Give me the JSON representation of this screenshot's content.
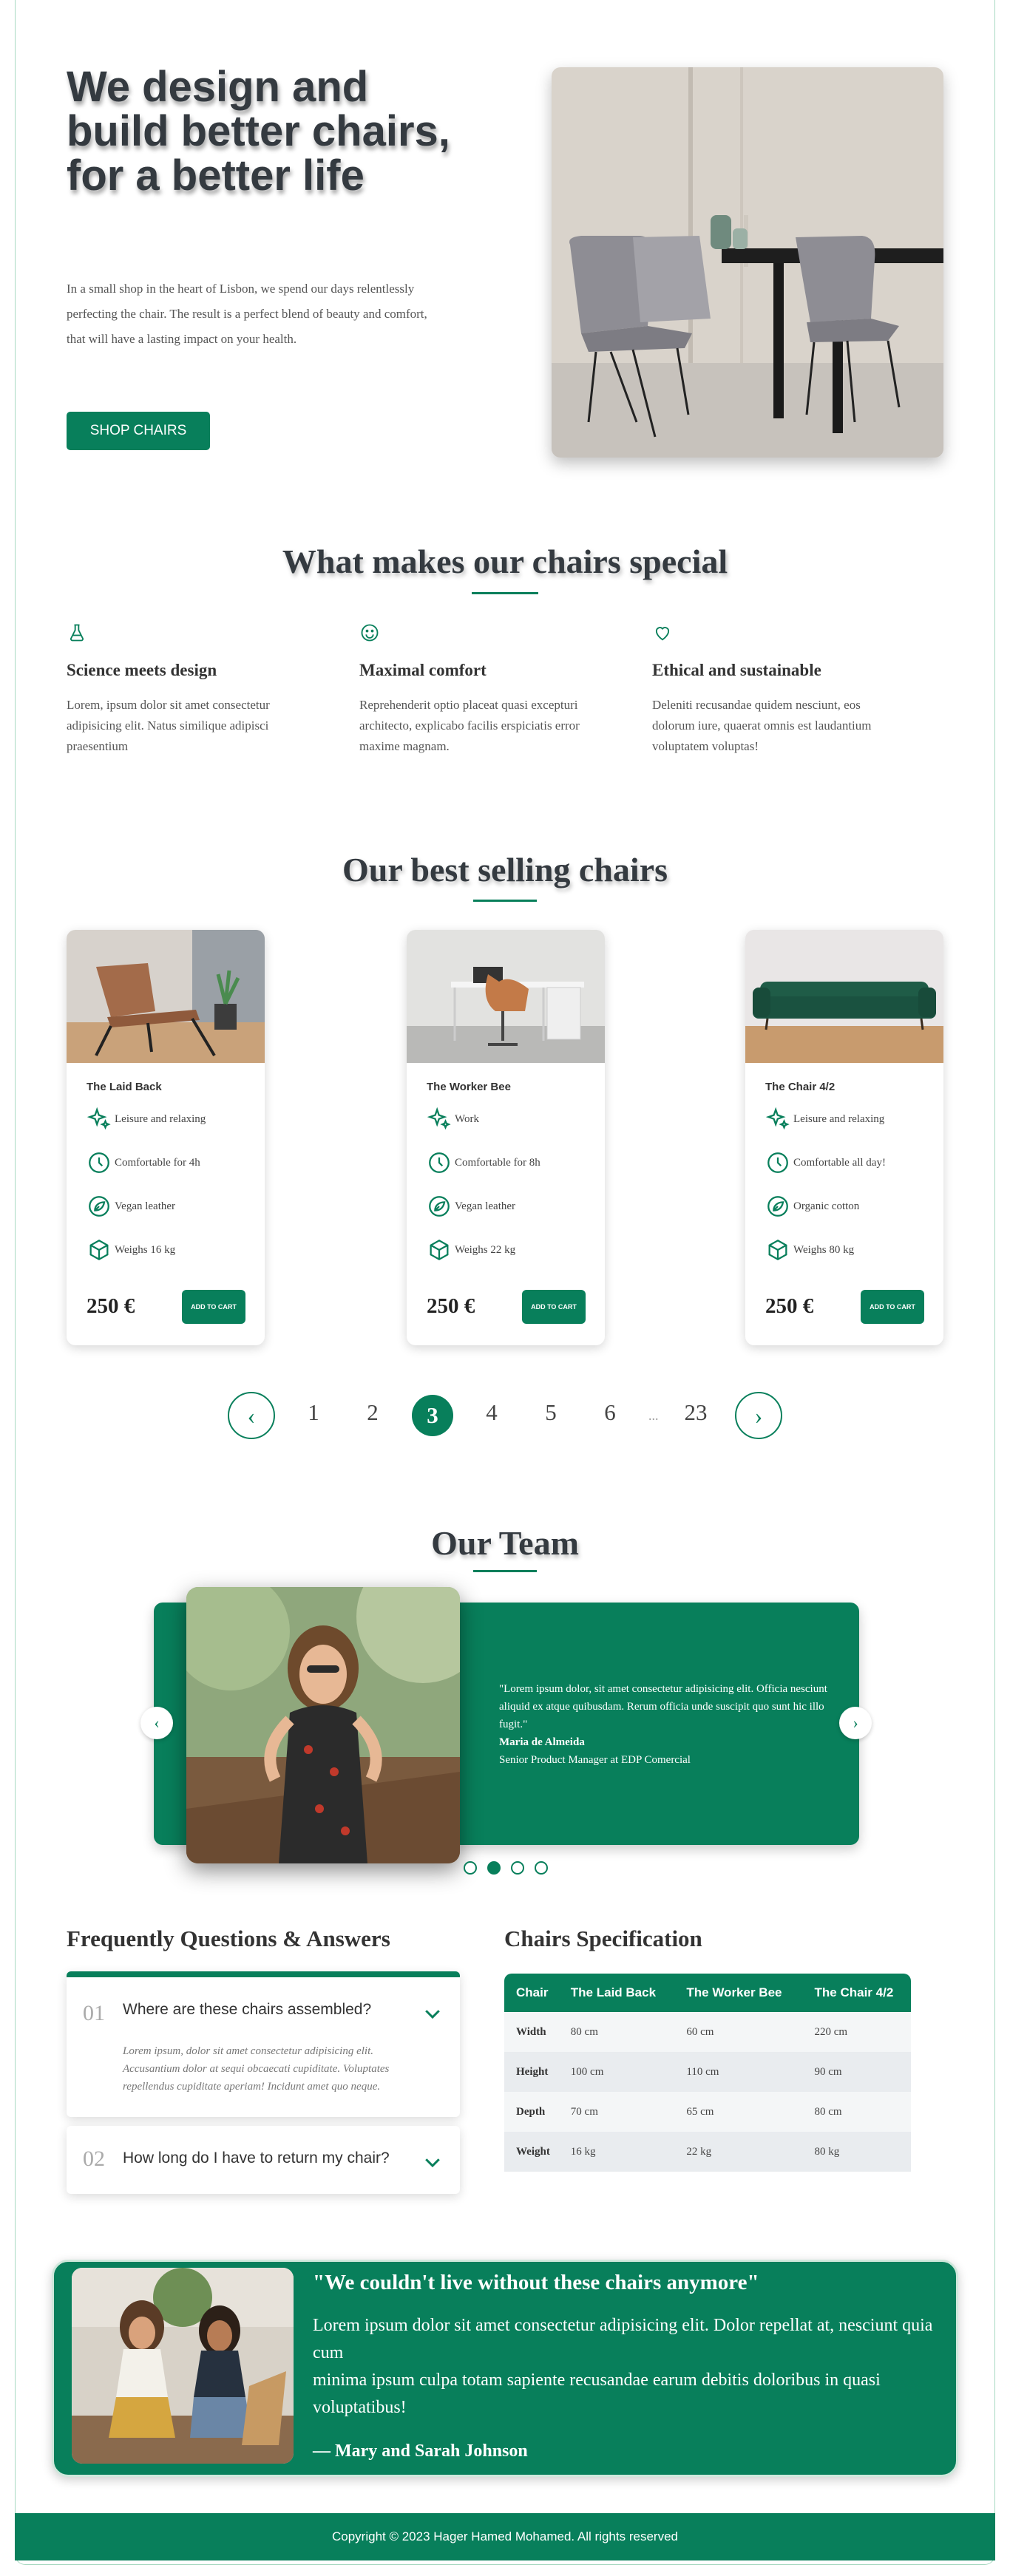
{
  "hero": {
    "title": "We design and build better chairs, for a better life",
    "text": "In a small shop in the heart of Lisbon, we spend our days relentlessly perfecting the chair. The result is a perfect blend of beauty and comfort, that will have a lasting impact on your health.",
    "button": "SHOP CHAIRS"
  },
  "features": {
    "title": "What makes our chairs special",
    "items": [
      {
        "icon": "flask-icon",
        "title": "Science meets design",
        "text": "Lorem, ipsum dolor sit amet consectetur adipisicing elit. Natus similique adipisci praesentium"
      },
      {
        "icon": "smile-icon",
        "title": "Maximal comfort",
        "text": "Reprehenderit optio placeat quasi excepturi architecto, explicabo facilis erspiciatis error maxime magnam."
      },
      {
        "icon": "heart-icon",
        "title": "Ethical and sustainable",
        "text": "Deleniti recusandae quidem nesciunt, eos dolorum iure, quaerat omnis est laudantium voluptatem voluptas!"
      }
    ]
  },
  "products": {
    "title": "Our best selling chairs",
    "cart_label": "ADD TO CART",
    "items": [
      {
        "name": "The Laid Back",
        "attrs": [
          "Leisure and relaxing",
          "Comfortable for 4h",
          "Vegan leather",
          "Weighs 16 kg"
        ],
        "price": "250 €"
      },
      {
        "name": "The Worker Bee",
        "attrs": [
          "Work",
          "Comfortable for 8h",
          "Vegan leather",
          "Weighs 22 kg"
        ],
        "price": "250 €"
      },
      {
        "name": "The Chair 4/2",
        "attrs": [
          "Leisure and relaxing",
          "Comfortable all day!",
          "Organic cotton",
          "Weighs 80 kg"
        ],
        "price": "250 €"
      }
    ]
  },
  "pagination": {
    "prev": "‹",
    "next": "›",
    "pages": [
      "1",
      "2",
      "3",
      "4",
      "5",
      "6"
    ],
    "current": "3",
    "ellipsis": "...",
    "last": "23"
  },
  "team": {
    "title": "Our Team",
    "quote": "\"Lorem ipsum dolor, sit amet consectetur adipisicing elit. Officia nesciunt aliquid ex atque quibusdam. Rerum officia unde suscipit quo sunt hic illo fugit.\"",
    "name": "Maria de Almeida",
    "role": "Senior Product Manager at EDP Comercial"
  },
  "faq": {
    "title": "Frequently Questions & Answers",
    "items": [
      {
        "num": "01",
        "question": "Where are these chairs assembled?",
        "answer": "Lorem ipsum, dolor sit amet consectetur adipisicing elit. Accusantium dolor at sequi obcaecati cupiditate. Voluptates repellendus cupiditate aperiam! Incidunt amet quo neque."
      },
      {
        "num": "02",
        "question": "How long do I have to return my chair?"
      }
    ]
  },
  "spec": {
    "title": "Chairs Specification",
    "headers": [
      "Chair",
      "The Laid Back",
      "The Worker Bee",
      "The Chair 4/2"
    ],
    "rows": [
      [
        "Width",
        "80 cm",
        "60 cm",
        "220 cm"
      ],
      [
        "Height",
        "100 cm",
        "110 cm",
        "90 cm"
      ],
      [
        "Depth",
        "70 cm",
        "65 cm",
        "80 cm"
      ],
      [
        "Weight",
        "16 kg",
        "22 kg",
        "80 kg"
      ]
    ]
  },
  "testimonial": {
    "heading": "\"We couldn't live without these chairs anymore\"",
    "body_1": "Lorem ipsum dolor sit amet consectetur adipisicing elit. Dolor repellat at, nesciunt quia cum",
    "body_2": "minima ipsum culpa totam sapiente recusandae earum debitis doloribus in quasi voluptatibus!",
    "author": "— Mary and Sarah Johnson"
  },
  "footer": {
    "text": "Copyright © 2023 Hager Hamed Mohamed. All rights reserved"
  },
  "colors": {
    "accent": "#087f5b"
  }
}
